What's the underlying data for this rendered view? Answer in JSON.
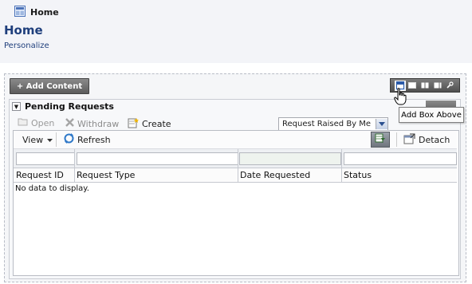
{
  "tab": {
    "label": "Home",
    "icon": "home-page-icon"
  },
  "header": {
    "title": "Home",
    "personalize_link": "Personalize"
  },
  "design": {
    "add_content_label": "+ Add Content",
    "layout_icons": [
      "add-box-above-icon",
      "single-column-layout-icon",
      "two-column-layout-icon",
      "three-column-layout-icon",
      "wrench-icon"
    ],
    "tooltip": "Add Box Above"
  },
  "box": {
    "title": "Pending Requests",
    "toolbar": {
      "open_label": "Open",
      "withdraw_label": "Withdraw",
      "create_label": "Create",
      "filter_select_value": "Request Raised By Me"
    },
    "table_toolbar": {
      "view_label": "View",
      "refresh_label": "Refresh",
      "detach_label": "Detach"
    },
    "columns": [
      "Request ID",
      "Request Type",
      "Date Requested",
      "Status"
    ],
    "empty_message": "No data to display."
  },
  "colors": {
    "title_blue": "#1f3f7c",
    "tooltip_bg": "#fafafa"
  }
}
